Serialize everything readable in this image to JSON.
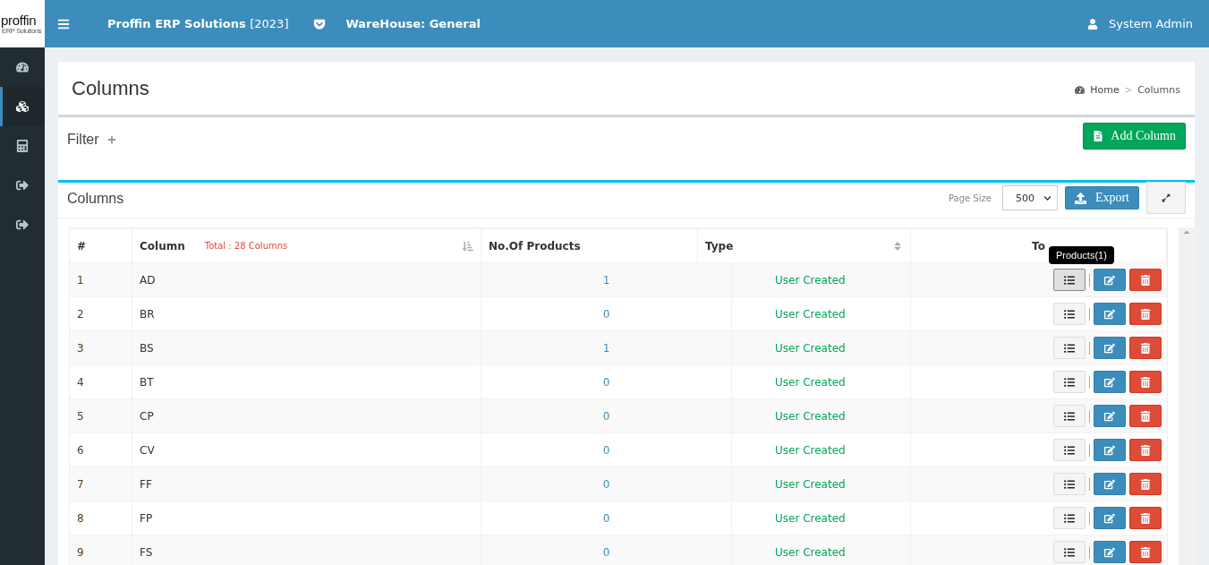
{
  "logo": {
    "name": "proffin",
    "tagline": "ERP Solutions"
  },
  "topbar": {
    "brand": "Proffin ERP Solutions",
    "year": "[2023]",
    "warehouse": "WareHouse: General",
    "user": "System Admin"
  },
  "sidebar": {
    "items": [
      {
        "kind": "dashboard",
        "selected": false
      },
      {
        "kind": "cubes",
        "selected": true
      },
      {
        "kind": "calculator",
        "selected": false
      },
      {
        "kind": "signout",
        "selected": false
      },
      {
        "kind": "signout",
        "selected": false
      }
    ]
  },
  "page": {
    "title": "Columns",
    "breadcrumb": [
      "Home",
      "Columns"
    ],
    "breadcrumb_separator": ">"
  },
  "filter": {
    "label": "Filter",
    "add_button": "Add Column"
  },
  "list": {
    "title": "Columns",
    "page_size_label": "Page Size",
    "page_size": "500",
    "export_button": "Export"
  },
  "table": {
    "columns": [
      {
        "label": "#"
      },
      {
        "label": "Column",
        "note": "Total : 28 Columns"
      },
      {
        "label": "No.Of Products"
      },
      {
        "label": "Type"
      },
      {
        "label": "To"
      }
    ],
    "rows": [
      {
        "no": "1",
        "column": "AD",
        "products": "1",
        "type": "User Created",
        "hovered": true,
        "tooltip": "Products(1)"
      },
      {
        "no": "2",
        "column": "BR",
        "products": "0",
        "type": "User Created",
        "hovered": false
      },
      {
        "no": "3",
        "column": "BS",
        "products": "1",
        "type": "User Created",
        "hovered": false
      },
      {
        "no": "4",
        "column": "BT",
        "products": "0",
        "type": "User Created",
        "hovered": false
      },
      {
        "no": "5",
        "column": "CP",
        "products": "0",
        "type": "User Created",
        "hovered": false
      },
      {
        "no": "6",
        "column": "CV",
        "products": "0",
        "type": "User Created",
        "hovered": false
      },
      {
        "no": "7",
        "column": "FF",
        "products": "0",
        "type": "User Created",
        "hovered": false
      },
      {
        "no": "8",
        "column": "FP",
        "products": "0",
        "type": "User Created",
        "hovered": false
      },
      {
        "no": "9",
        "column": "FS",
        "products": "0",
        "type": "User Created",
        "hovered": false
      }
    ]
  }
}
